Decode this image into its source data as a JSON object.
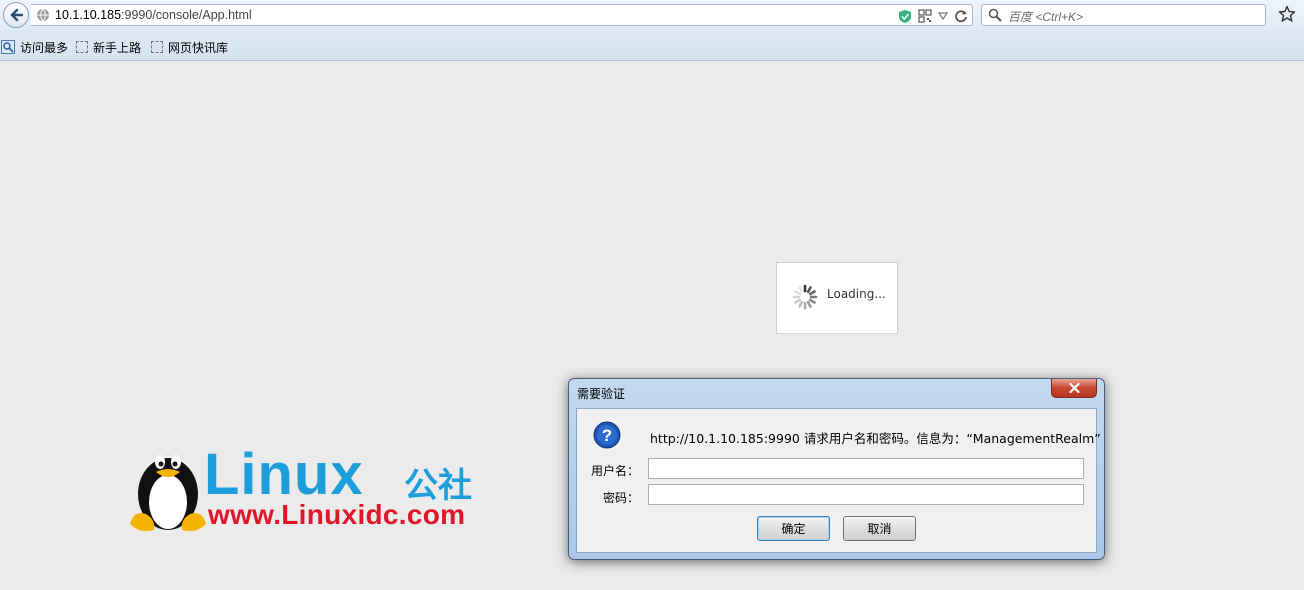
{
  "browser": {
    "url_host": "10.1.10.185",
    "url_rest": ":9990/console/App.html",
    "search_placeholder": "百度 <Ctrl+K>",
    "icons": {
      "back": "back-arrow-icon",
      "site": "globe-icon",
      "shield": "shield-check-icon",
      "qr": "qr-code-icon",
      "dropdown": "dropdown-triangle-icon",
      "reload": "reload-icon",
      "search": "search-icon",
      "bookmark_star": "star-icon"
    }
  },
  "bookmarks": [
    {
      "label": "访问最多",
      "icon": "bookmark-folder-icon"
    },
    {
      "label": "新手上路",
      "icon": "page-placeholder-icon"
    },
    {
      "label": "网页快讯库",
      "icon": "page-placeholder-icon"
    }
  ],
  "loading": {
    "text": "Loading..."
  },
  "logo": {
    "main": "Linux",
    "cn": "公社",
    "url": "www.Linuxidc.com"
  },
  "dialog": {
    "title": "需要验证",
    "message": "http://10.1.10.185:9990 请求用户名和密码。信息为：“ManagementRealm”",
    "username_label": "用户名：",
    "password_label": "密码：",
    "username_value": "",
    "password_value": "",
    "ok_label": "确定",
    "cancel_label": "取消"
  },
  "colors": {
    "page_bg": "#ebebeb",
    "logo_blue": "#1c9edb",
    "logo_red": "#e0162b",
    "dialog_frame": "#a9c8e8",
    "close_red": "#c8452e"
  }
}
